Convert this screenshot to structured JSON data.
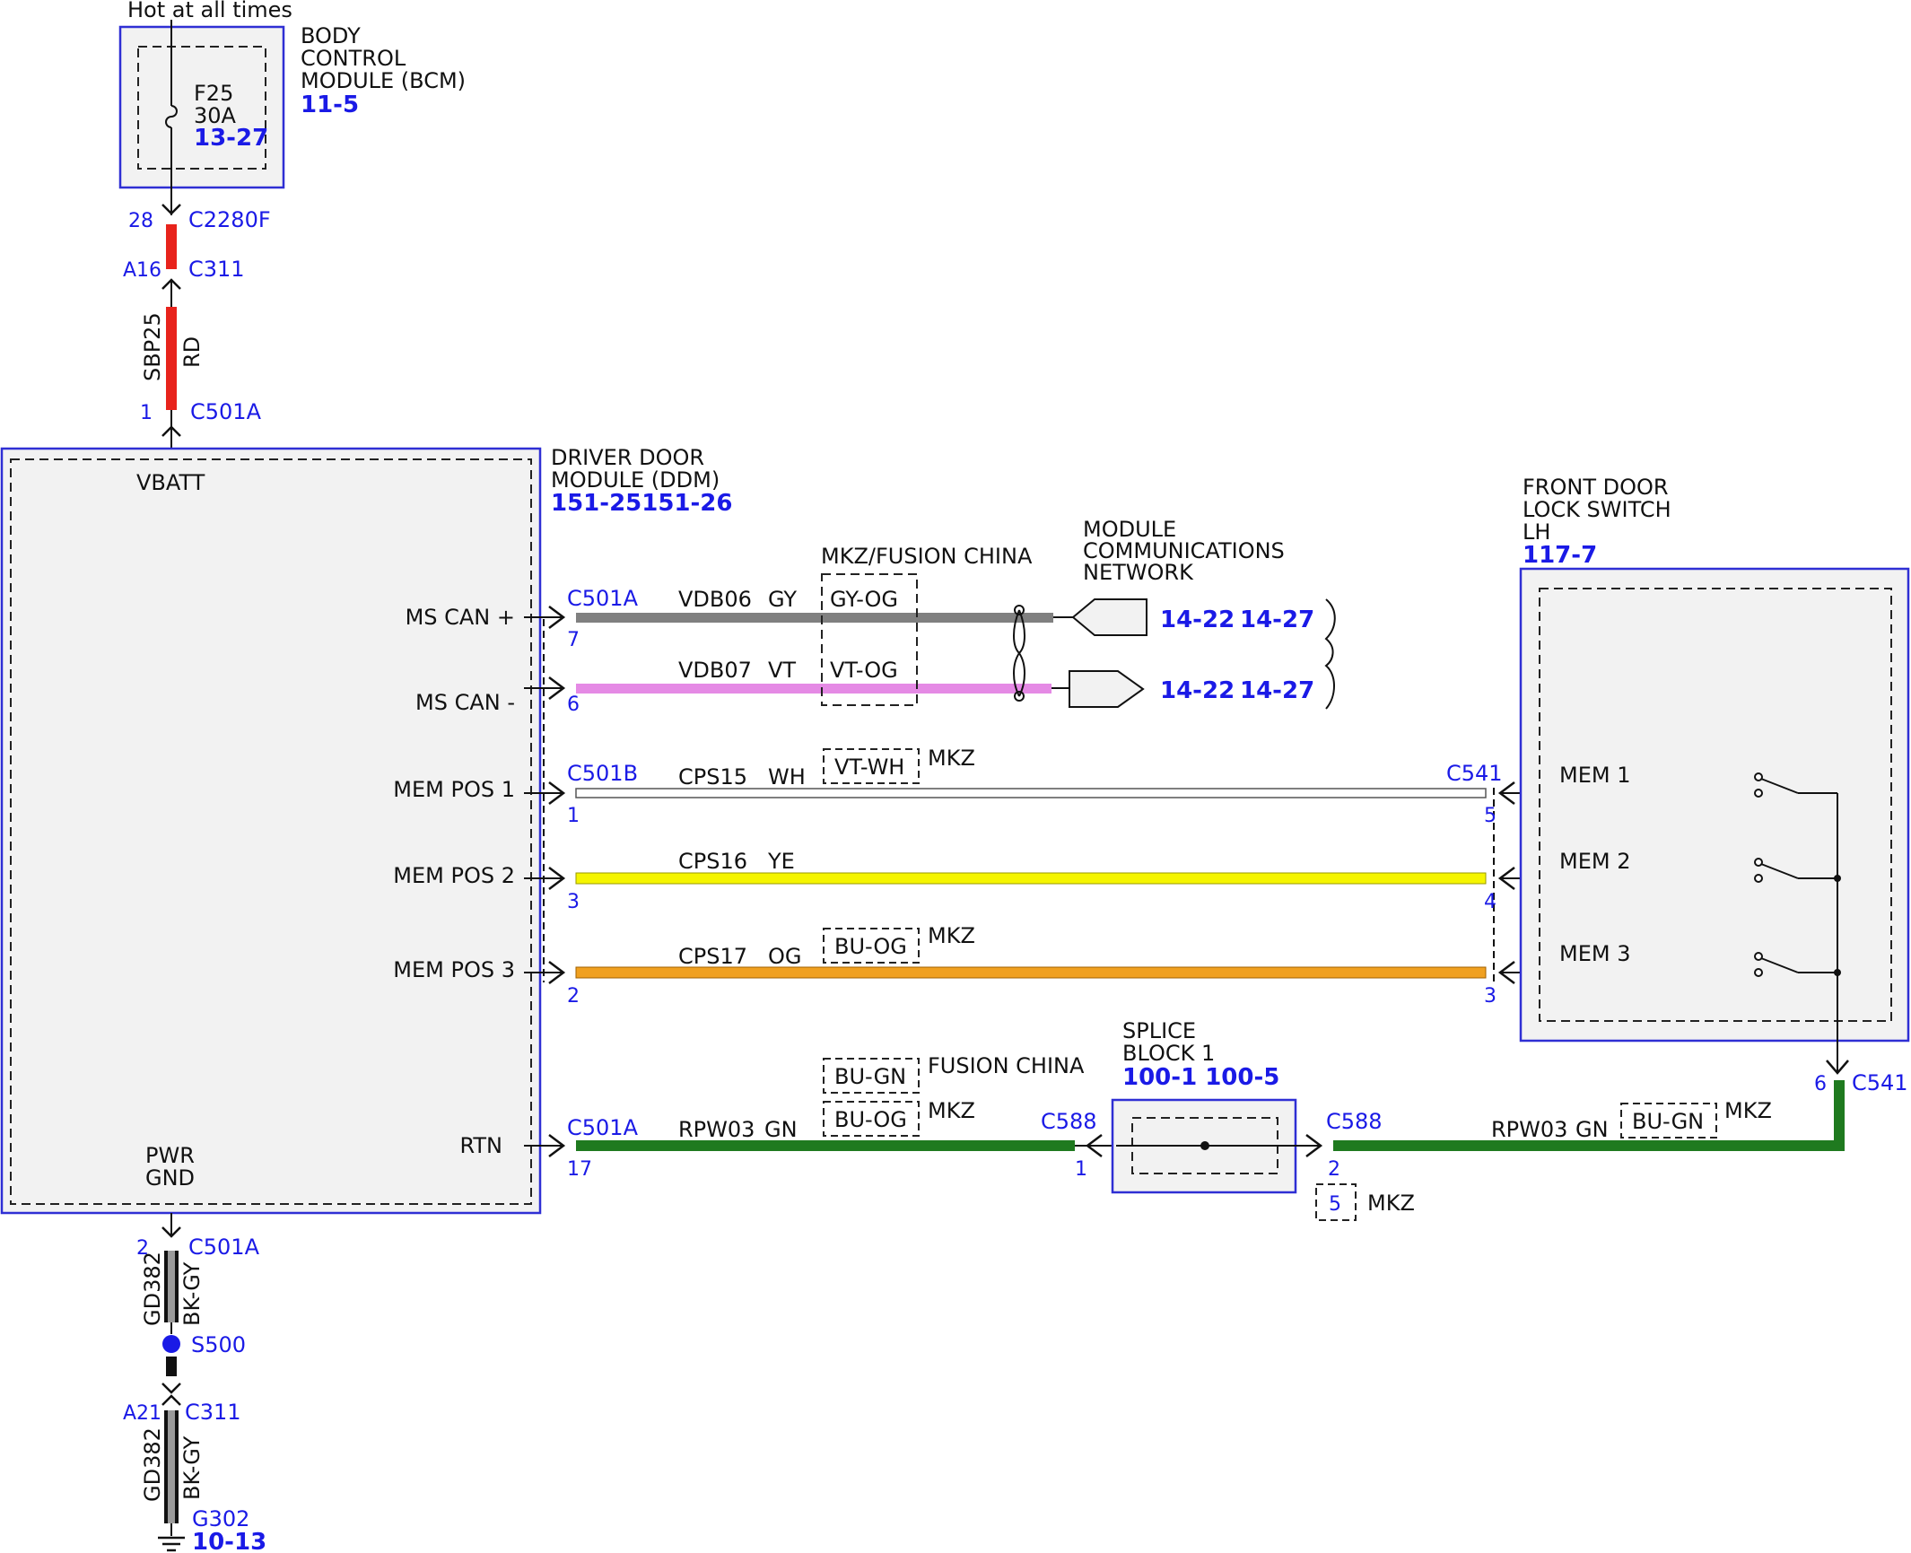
{
  "colors": {
    "module_outline": "#2f2fd4",
    "reference_text": "#1a1ae6",
    "wire_RD": "#e8231c",
    "wire_GY": "#808080",
    "wire_VT": "#e58ae5",
    "wire_WH": "#ffffff",
    "wire_YE": "#f5f500",
    "wire_OG": "#f0a020",
    "wire_GN": "#1f7a1f",
    "wire_BK": "#111111",
    "splice": "#1a1ae6"
  },
  "power_source": {
    "label": "Hot at all times"
  },
  "bcm": {
    "name_lines": [
      "BODY",
      "CONTROL",
      "MODULE (BCM)"
    ],
    "ref": "11-5",
    "fuse_name": "F25",
    "fuse_rating": "30A",
    "fuse_ref": "13-27"
  },
  "bcm_feed": {
    "pin_top": "28",
    "conn_top": "C2280F",
    "pin_mid": "A16",
    "conn_mid": "C311",
    "circuit": "SBP25",
    "color": "RD",
    "pin_ddm": "1",
    "conn_ddm": "C501A"
  },
  "ddm": {
    "name_lines": [
      "DRIVER DOOR",
      "MODULE (DDM)"
    ],
    "ref": "151-25151-26",
    "vbatt_label": "VBATT",
    "pwr_gnd_lines": [
      "PWR",
      "GND"
    ],
    "pin_labels": {
      "ms_can_plus": "MS CAN +",
      "ms_can_minus": "MS CAN -",
      "mem_pos_1": "MEM POS 1",
      "mem_pos_2": "MEM POS 2",
      "mem_pos_3": "MEM POS 3",
      "rtn": "RTN"
    }
  },
  "option_labels": {
    "mkz_fusion_china": "MKZ/FUSION CHINA",
    "mkz": "MKZ",
    "fusion_china": "FUSION CHINA"
  },
  "network": {
    "title_lines": [
      "MODULE",
      "COMMUNICATIONS",
      "NETWORK"
    ],
    "ref_a": "14-22",
    "ref_b": "14-27"
  },
  "wires": {
    "can_plus": {
      "conn": "C501A",
      "pin": "7",
      "circuit": "VDB06",
      "color": "GY",
      "alt_color": "GY-OG"
    },
    "can_minus": {
      "pin": "6",
      "circuit": "VDB07",
      "color": "VT",
      "alt_color": "VT-OG"
    },
    "mem1": {
      "conn_left": "C501B",
      "pin_left": "1",
      "circuit": "CPS15",
      "color": "WH",
      "alt_color": "VT-WH",
      "conn_right": "C541",
      "pin_right": "5"
    },
    "mem2": {
      "pin_left": "3",
      "circuit": "CPS16",
      "color": "YE",
      "pin_right": "4"
    },
    "mem3": {
      "pin_left": "2",
      "circuit": "CPS17",
      "color": "OG",
      "alt_color": "BU-OG",
      "pin_right": "3"
    },
    "rtn_left": {
      "conn_left": "C501A",
      "pin_left": "17",
      "circuit": "RPW03",
      "color": "GN",
      "alt_fusion_china": "BU-GN",
      "alt_mkz": "BU-OG",
      "conn_right": "C588",
      "pin_right": "1"
    },
    "rtn_right": {
      "conn_left": "C588",
      "pin_left": "2",
      "alt_pin_mkz": "5",
      "circuit": "RPW03",
      "color": "GN",
      "alt_color": "BU-GN",
      "conn_switch": "C541",
      "pin_switch": "6"
    }
  },
  "splice_block": {
    "name_lines": [
      "SPLICE",
      "BLOCK 1"
    ],
    "ref": "100-1 100-5"
  },
  "door_switch": {
    "name_lines": [
      "FRONT DOOR",
      "LOCK SWITCH",
      "LH"
    ],
    "ref": "117-7",
    "contacts": [
      "MEM 1",
      "MEM 2",
      "MEM 3"
    ]
  },
  "ground": {
    "pin_ddm": "2",
    "conn_ddm": "C501A",
    "circuit": "GD382",
    "color": "BK-GY",
    "splice": "S500",
    "pin_mid": "A21",
    "conn_mid": "C311",
    "ground_point": "G302",
    "ground_ref": "10-13"
  }
}
